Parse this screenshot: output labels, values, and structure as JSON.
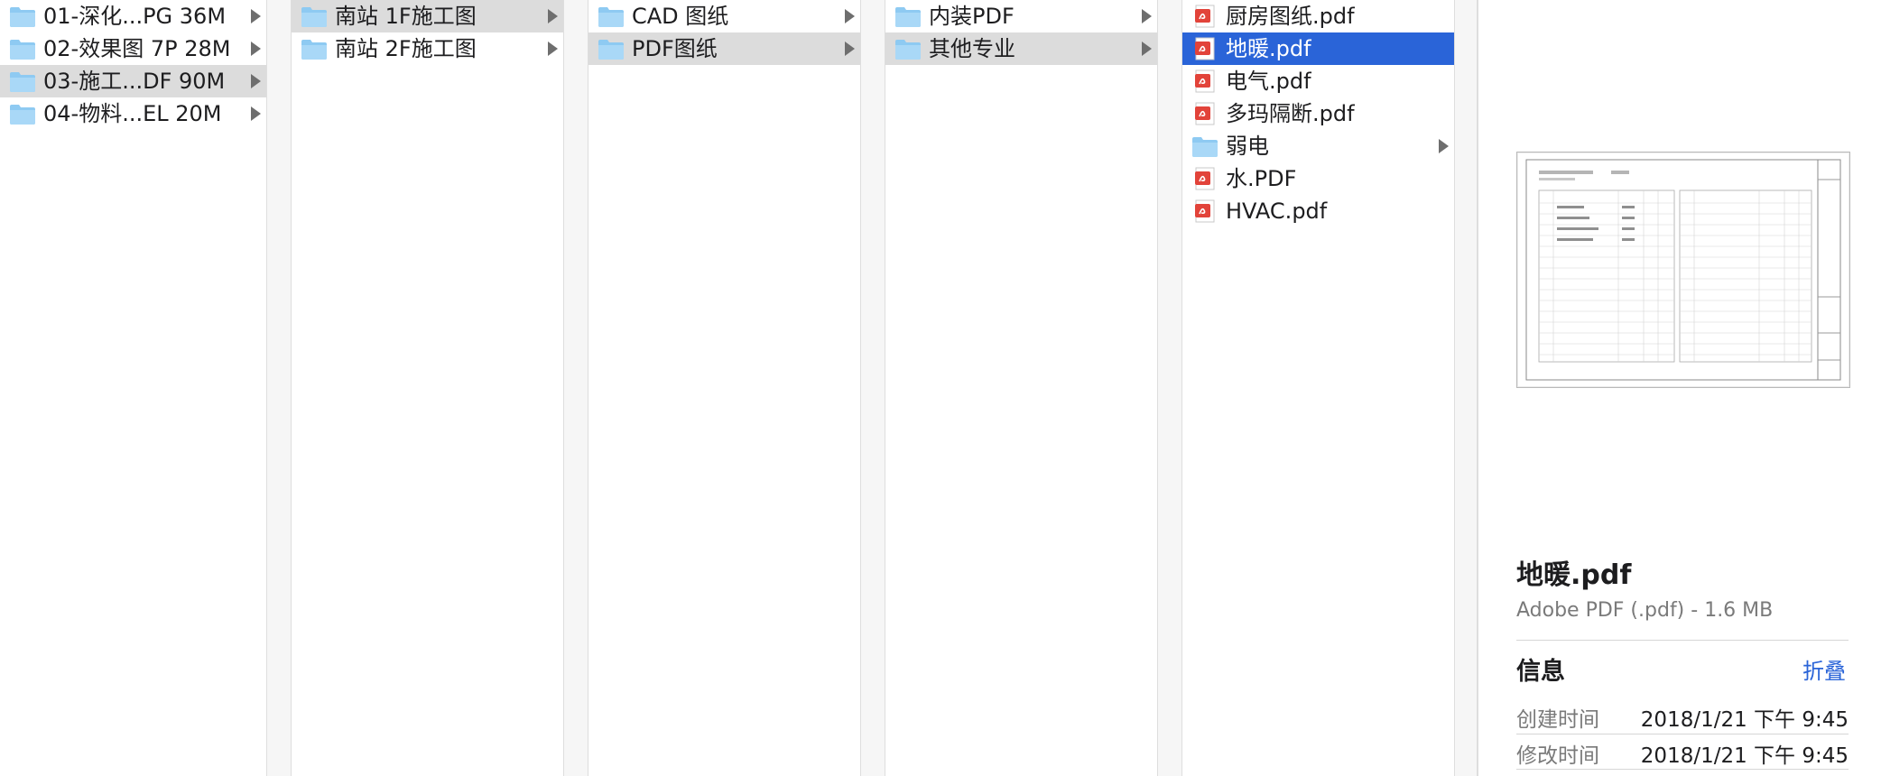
{
  "columns": [
    {
      "items": [
        {
          "label": "01-深化...PG 36M",
          "type": "folder",
          "selected": "none"
        },
        {
          "label": "02-效果图 7P 28M",
          "type": "folder",
          "selected": "none"
        },
        {
          "label": "03-施工...DF 90M",
          "type": "folder",
          "selected": "gray"
        },
        {
          "label": "04-物料...EL 20M",
          "type": "folder",
          "selected": "none"
        }
      ]
    },
    {
      "items": [
        {
          "label": "南站 1F施工图",
          "type": "folder",
          "selected": "gray"
        },
        {
          "label": "南站 2F施工图",
          "type": "folder",
          "selected": "none"
        }
      ]
    },
    {
      "items": [
        {
          "label": "CAD 图纸",
          "type": "folder",
          "selected": "none"
        },
        {
          "label": "PDF图纸",
          "type": "folder",
          "selected": "gray"
        }
      ]
    },
    {
      "items": [
        {
          "label": "内装PDF",
          "type": "folder",
          "selected": "none"
        },
        {
          "label": "其他专业",
          "type": "folder",
          "selected": "gray"
        }
      ]
    },
    {
      "items": [
        {
          "label": "厨房图纸.pdf",
          "type": "pdf",
          "selected": "none"
        },
        {
          "label": "地暖.pdf",
          "type": "pdf",
          "selected": "blue"
        },
        {
          "label": "电气.pdf",
          "type": "pdf",
          "selected": "none"
        },
        {
          "label": "多玛隔断.pdf",
          "type": "pdf",
          "selected": "none"
        },
        {
          "label": "弱电",
          "type": "folder",
          "selected": "none"
        },
        {
          "label": "水.PDF",
          "type": "pdf",
          "selected": "none"
        },
        {
          "label": "HVAC.pdf",
          "type": "pdf",
          "selected": "none"
        }
      ]
    }
  ],
  "preview": {
    "file_name": "地暖.pdf",
    "file_kind": "Adobe PDF (.pdf) - 1.6 MB",
    "info_label": "信息",
    "fold_label": "折叠",
    "created_label": "创建时间",
    "created_value": "2018/1/21 下午 9:45",
    "modified_label": "修改时间",
    "modified_value": "2018/1/21 下午 9:45"
  },
  "colors": {
    "selection_blue": "#2a64d8",
    "selection_gray": "#dcdcdc",
    "folder_blue": "#8ecaf2",
    "pdf_red": "#e2433a"
  }
}
